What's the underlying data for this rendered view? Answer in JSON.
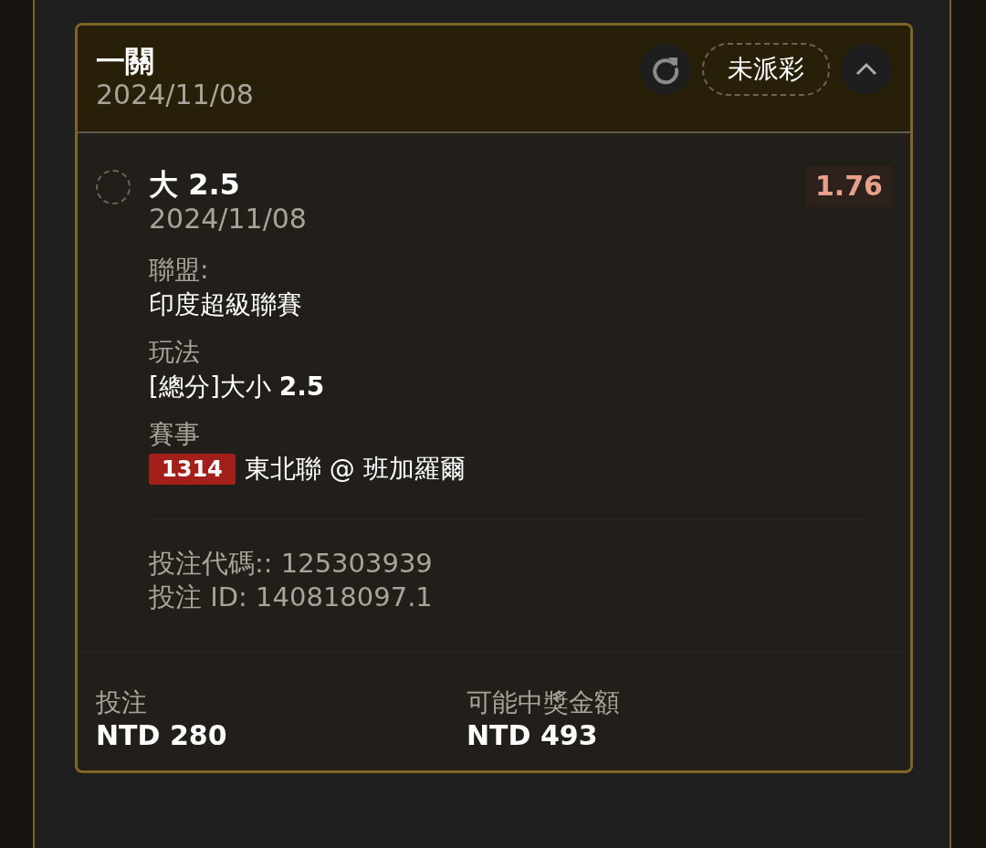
{
  "bet_card": {
    "title": "一關",
    "date": "2024/11/08",
    "status": "未派彩",
    "expanded": true,
    "selection": {
      "checked": false,
      "name": "大 2.5",
      "date": "2024/11/08",
      "odds": "1.76",
      "details": [
        {
          "label": "聯盟:",
          "value": "印度超級聯賽"
        },
        {
          "label": "玩法",
          "value": "[總分]大小 **2.5**"
        },
        {
          "label": "賽事",
          "badge": "1314",
          "value": "東北聯 @ 班加羅爾"
        }
      ],
      "bet_code": "投注代碼:: 125303939",
      "bet_id": "投注 ID: 140818097.1"
    },
    "summary": [
      {
        "label": "投注",
        "value": "NTD 280"
      },
      {
        "label": "可能中獎金額",
        "value": "NTD 493"
      }
    ]
  }
}
